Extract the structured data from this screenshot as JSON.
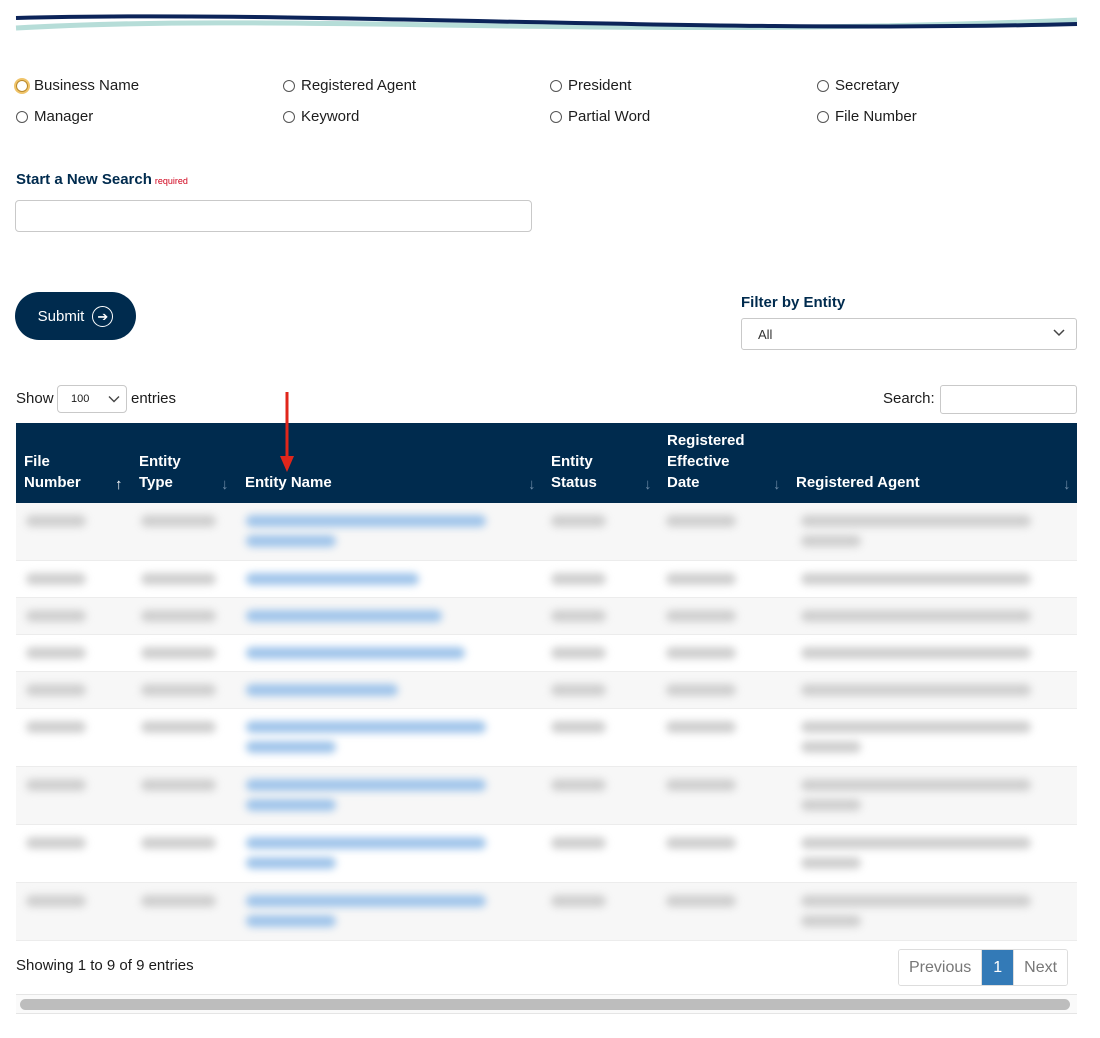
{
  "search_types": [
    [
      {
        "label": "Business Name",
        "focused": true
      },
      {
        "label": "Registered Agent"
      },
      {
        "label": "President"
      },
      {
        "label": "Secretary"
      }
    ],
    [
      {
        "label": "Manager"
      },
      {
        "label": "Keyword"
      },
      {
        "label": "Partial Word"
      },
      {
        "label": "File Number"
      }
    ]
  ],
  "new_search": {
    "label": "Start a New Search",
    "required": "required",
    "value": ""
  },
  "submit": {
    "label": "Submit"
  },
  "filter": {
    "label": "Filter by Entity",
    "selected": "All"
  },
  "table_controls": {
    "show_label": "Show",
    "page_size": "100",
    "entries_label": "entries",
    "search_label": "Search:"
  },
  "table": {
    "columns": [
      {
        "line1": "",
        "line2": "File",
        "line3": "Number",
        "sort": "↑"
      },
      {
        "line1": "",
        "line2": "Entity",
        "line3": "Type",
        "sort": "↓"
      },
      {
        "line1": "",
        "line2": "",
        "line3": "Entity Name",
        "sort": "↓"
      },
      {
        "line1": "",
        "line2": "Entity",
        "line3": "Status",
        "sort": "↓"
      },
      {
        "line1": "Registered",
        "line2": "Effective",
        "line3": "Date",
        "sort": "↓"
      },
      {
        "line1": "",
        "line2": "",
        "line3": "Registered Agent",
        "sort": "↓"
      }
    ],
    "row_count": 9
  },
  "footer": {
    "showing": "Showing 1 to 9 of 9 entries",
    "prev": "Previous",
    "page": "1",
    "next": "Next"
  },
  "colors": {
    "navy": "#002b4e",
    "teal_wave": "#b6ddd8",
    "link_blue": "#337ab7",
    "required_red": "#d0021b",
    "annotation_red": "#e0261b"
  }
}
